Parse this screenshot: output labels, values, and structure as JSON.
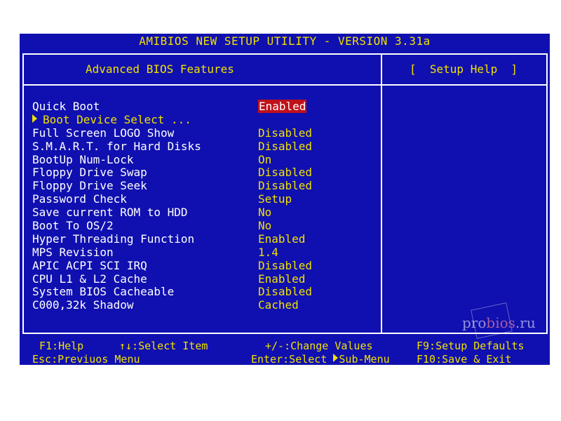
{
  "window": {
    "title": "AMIBIOS NEW SETUP UTILITY - VERSION 3.31a"
  },
  "page": {
    "title": "Advanced BIOS Features"
  },
  "help": {
    "title": "[  Setup Help  ]"
  },
  "items": [
    {
      "label": "Quick Boot",
      "value": "Enabled",
      "selected": true
    },
    {
      "label": "Boot Device Select ...",
      "value": "",
      "submenu": true
    },
    {
      "label": "Full Screen LOGO Show",
      "value": "Disabled"
    },
    {
      "label": "S.M.A.R.T. for Hard Disks",
      "value": "Disabled"
    },
    {
      "label": "BootUp Num-Lock",
      "value": "On"
    },
    {
      "label": "Floppy Drive Swap",
      "value": "Disabled"
    },
    {
      "label": "Floppy Drive Seek",
      "value": "Disabled"
    },
    {
      "label": "Password Check",
      "value": "Setup"
    },
    {
      "label": "Save current ROM to HDD",
      "value": "No"
    },
    {
      "label": "Boot To OS/2",
      "value": "No"
    },
    {
      "label": "Hyper Threading Function",
      "value": "Enabled"
    },
    {
      "label": "MPS Revision",
      "value": "1.4"
    },
    {
      "label": "APIC ACPI SCI IRQ",
      "value": "Disabled"
    },
    {
      "label": "CPU L1 & L2 Cache",
      "value": "Enabled"
    },
    {
      "label": "System BIOS Cacheable",
      "value": "Disabled"
    },
    {
      "label": "C000,32k Shadow",
      "value": "Cached"
    }
  ],
  "footer": {
    "f1": "F1:Help",
    "select_item": "↑↓:Select Item",
    "change_values": "+/-:Change Values",
    "f9": "F9:Setup Defaults",
    "esc": "Esc:Previuos Menu",
    "enter_prefix": "Enter:Select ",
    "enter_suffix": "Sub-Menu",
    "f10": "F10:Save & Exit"
  },
  "watermark": {
    "part1": "pro",
    "part2": "bios",
    "part3": ".ru"
  },
  "colors": {
    "background": "#1010b0",
    "text_yellow": "#f0e000",
    "text_white": "#ffffff",
    "highlight": "#c0101a"
  }
}
